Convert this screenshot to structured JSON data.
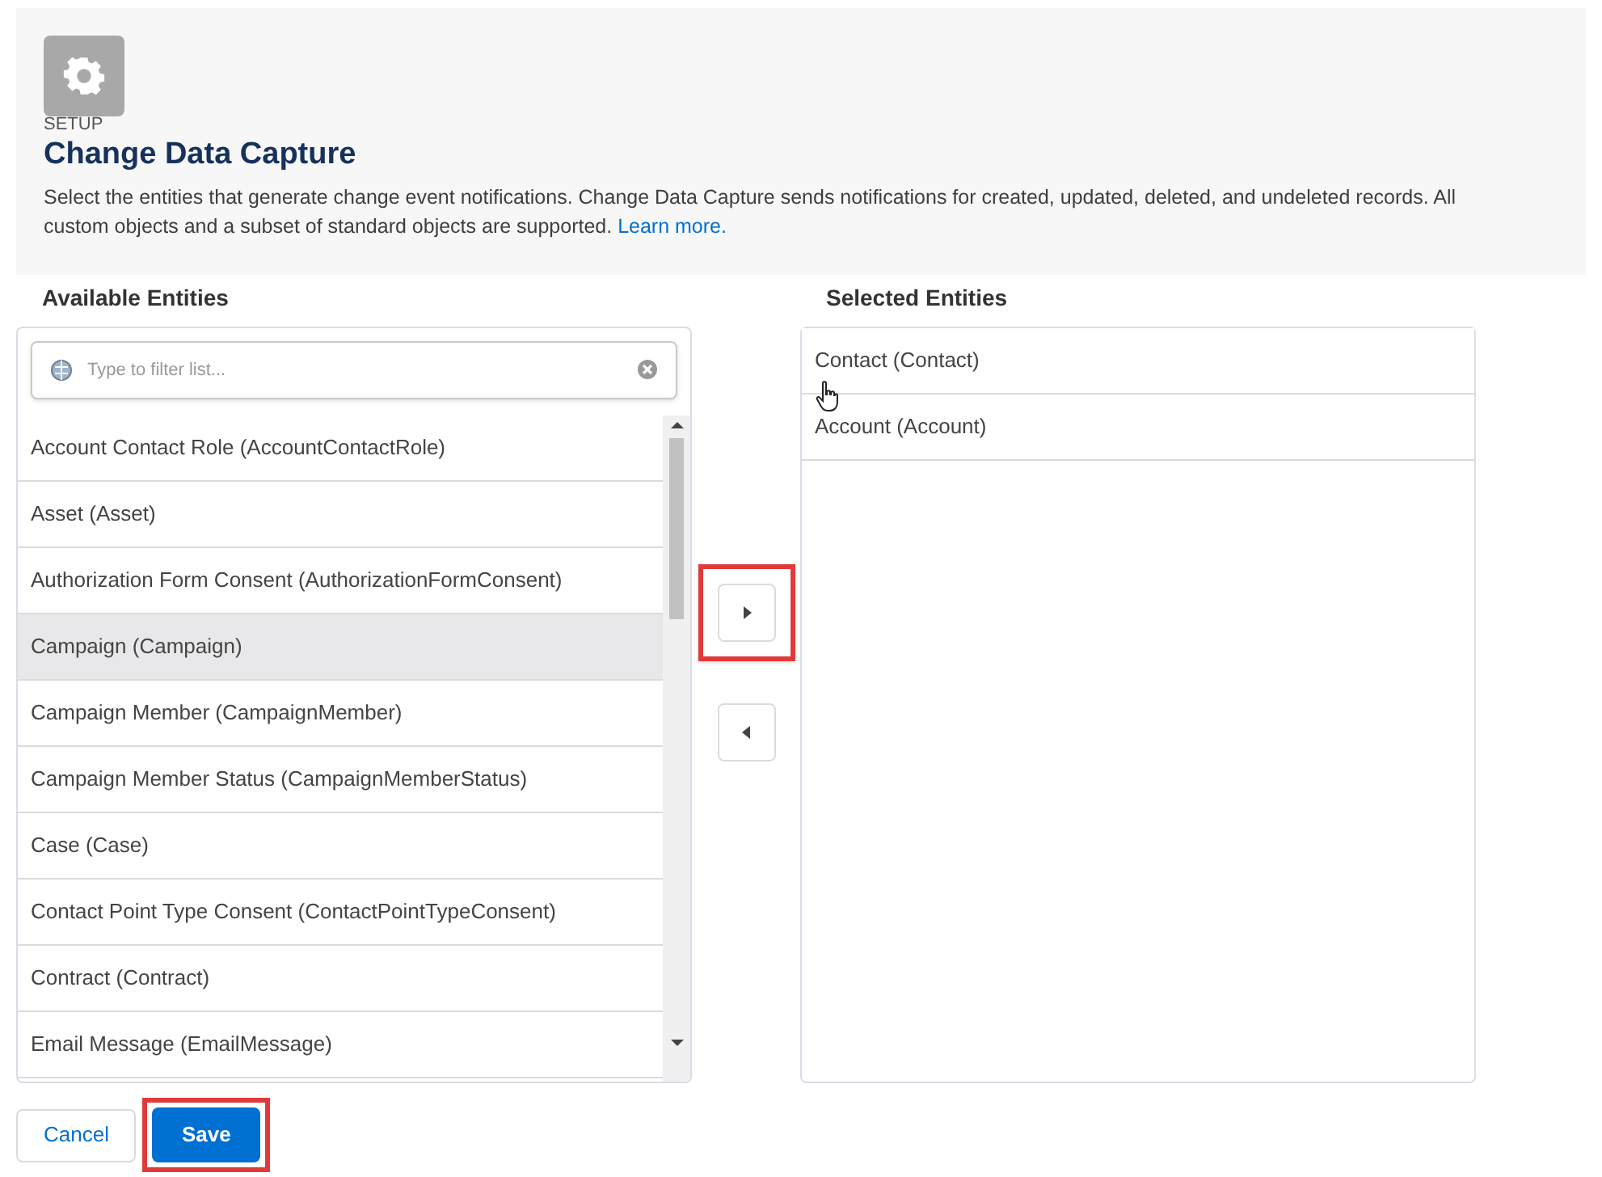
{
  "header": {
    "eyebrow": "SETUP",
    "title": "Change Data Capture",
    "description": "Select the entities that generate change event notifications. Change Data Capture sends notifications for created, updated, deleted, and undeleted records. All custom objects and a subset of standard objects are supported.",
    "link": "Learn more."
  },
  "available": {
    "heading": "Available Entities",
    "filter_placeholder": "Type to filter list...",
    "items": [
      {
        "label": "Account Contact Role (AccountContactRole)",
        "selected": false
      },
      {
        "label": "Asset (Asset)",
        "selected": false
      },
      {
        "label": "Authorization Form Consent (AuthorizationFormConsent)",
        "selected": false
      },
      {
        "label": "Campaign (Campaign)",
        "selected": true
      },
      {
        "label": "Campaign Member (CampaignMember)",
        "selected": false
      },
      {
        "label": "Campaign Member Status (CampaignMemberStatus)",
        "selected": false
      },
      {
        "label": "Case (Case)",
        "selected": false
      },
      {
        "label": "Contact Point Type Consent (ContactPointTypeConsent)",
        "selected": false
      },
      {
        "label": "Contract (Contract)",
        "selected": false
      },
      {
        "label": "Email Message (EmailMessage)",
        "selected": false
      }
    ]
  },
  "move_buttons": [
    {
      "kind": "add",
      "highlighted": true
    },
    {
      "kind": "remove",
      "highlighted": false
    }
  ],
  "selected": {
    "heading": "Selected Entities",
    "items": [
      {
        "label": "Contact (Contact)",
        "selected": false
      },
      {
        "label": "Account (Account)",
        "selected": false
      }
    ]
  },
  "buttons": [
    {
      "kind": "neutral",
      "label": "Cancel",
      "highlighted": false
    },
    {
      "kind": "brand",
      "label": "Save",
      "highlighted": true
    }
  ]
}
